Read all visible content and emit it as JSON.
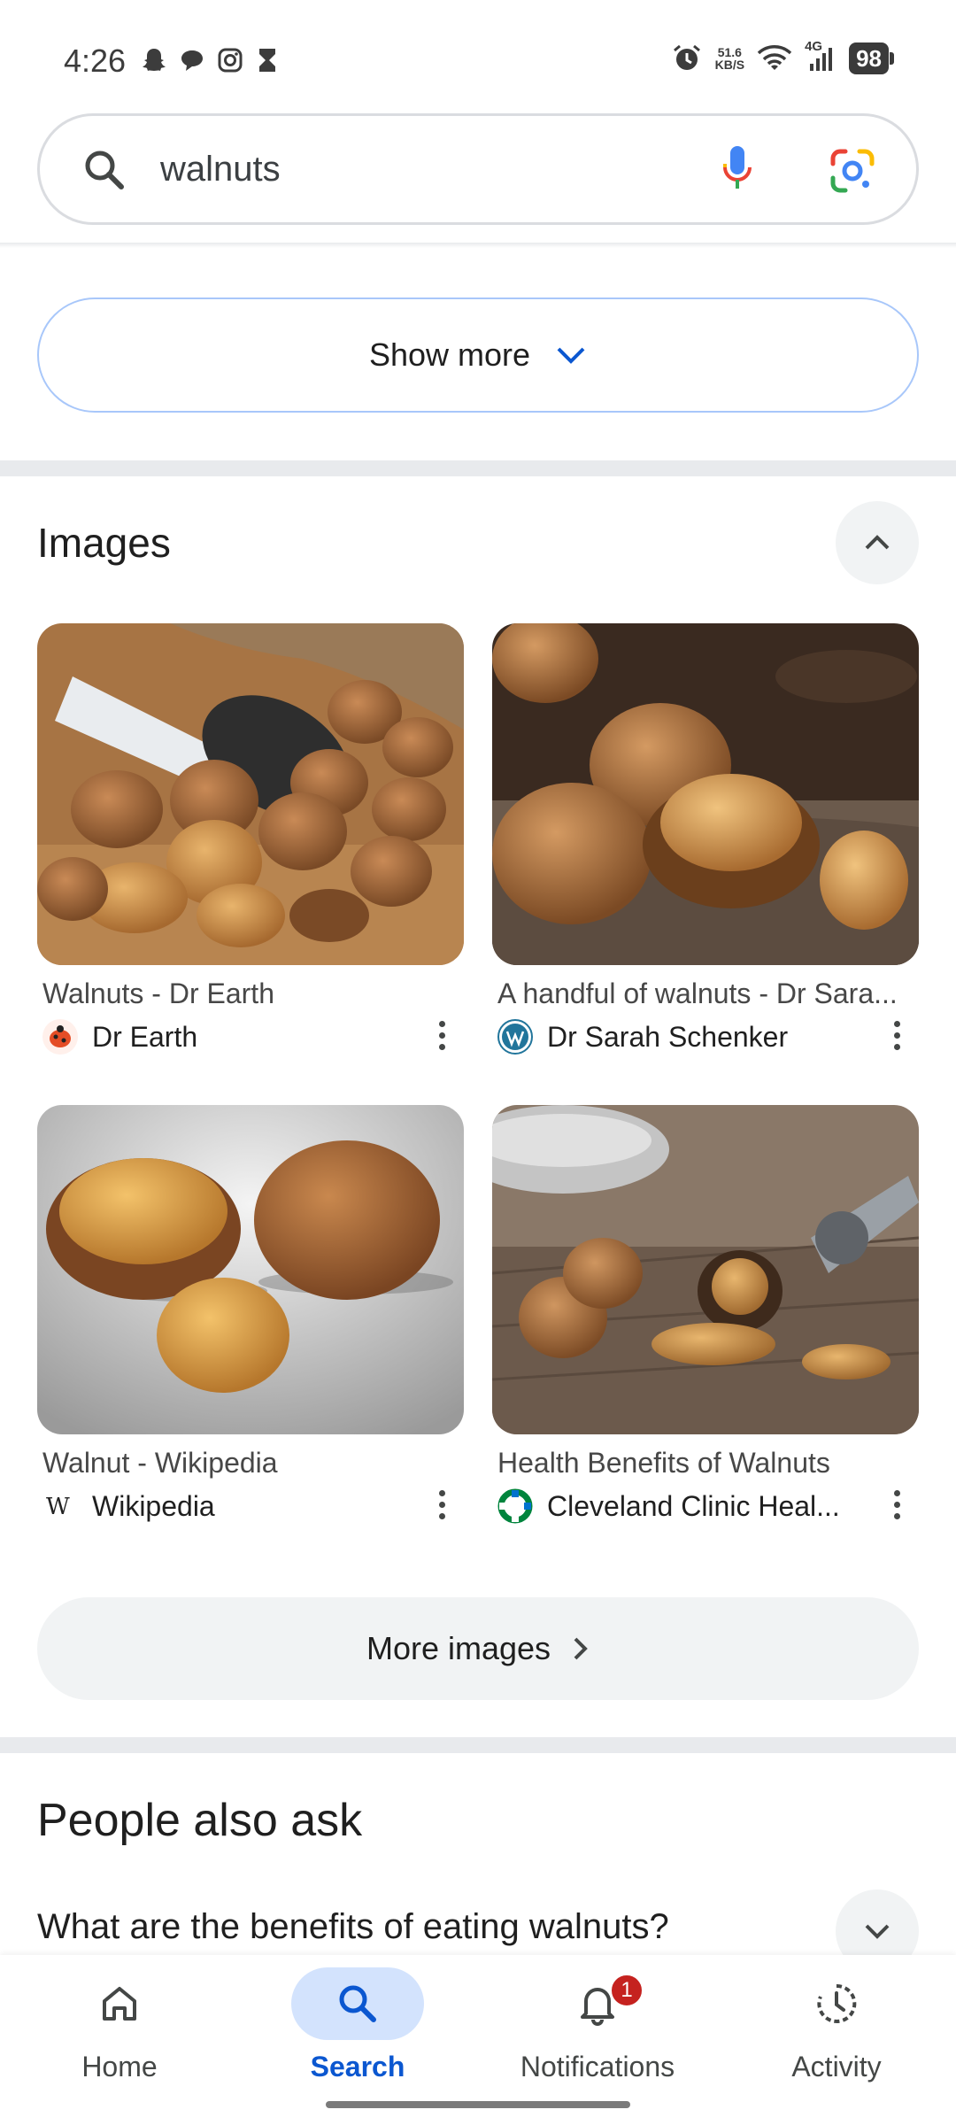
{
  "status_bar": {
    "time": "4:26",
    "net_speed_value": "51.6",
    "net_speed_unit": "KB/S",
    "network": "4G",
    "battery": "98",
    "left_icons": [
      "snapchat-icon",
      "chat-bubble-icon",
      "instagram-icon",
      "hourglass-icon"
    ],
    "right_icons": [
      "alarm-icon",
      "wifi-icon",
      "signal-icon"
    ]
  },
  "search": {
    "query": "walnuts"
  },
  "show_more": {
    "label": "Show more"
  },
  "images_section": {
    "title": "Images",
    "items": [
      {
        "title": "Walnuts - Dr Earth",
        "source": "Dr Earth"
      },
      {
        "title": "A handful of walnuts - Dr Sara...",
        "source": "Dr Sarah Schenker"
      },
      {
        "title": "Walnut - Wikipedia",
        "source": "Wikipedia"
      },
      {
        "title": "Health Benefits of Walnuts",
        "source": "Cleveland Clinic Heal..."
      }
    ],
    "more_label": "More images"
  },
  "people_also_ask": {
    "title": "People also ask",
    "questions": [
      "What are the benefits of eating walnuts?"
    ]
  },
  "bottom_nav": {
    "items": [
      {
        "label": "Home"
      },
      {
        "label": "Search"
      },
      {
        "label": "Notifications",
        "badge": "1"
      },
      {
        "label": "Activity"
      }
    ],
    "active": "Search"
  },
  "colors": {
    "accent": "#0b57d0",
    "active_pill": "#d3e3fd",
    "badge": "#c5221f",
    "chip_bg": "#f1f3f4"
  }
}
